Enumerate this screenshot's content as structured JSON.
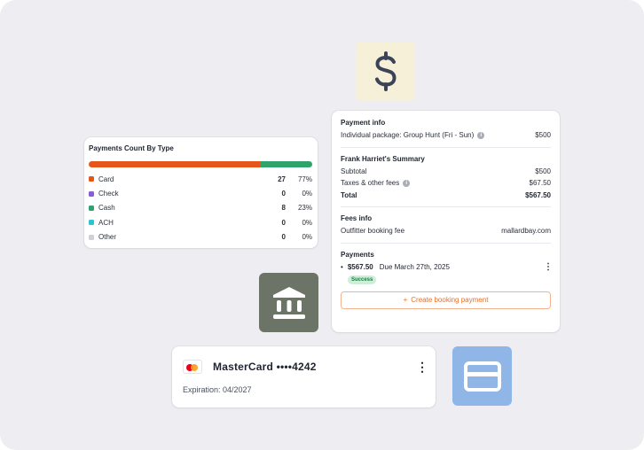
{
  "payments_count": {
    "title": "Payments Count By Type",
    "types": [
      {
        "label": "Card",
        "count": "27",
        "pct": "77%",
        "share": 0.77,
        "color": "#e6551a"
      },
      {
        "label": "Check",
        "count": "0",
        "pct": "0%",
        "share": 0,
        "color": "#8a5bd6"
      },
      {
        "label": "Cash",
        "count": "8",
        "pct": "23%",
        "share": 0.23,
        "color": "#2fa36b"
      },
      {
        "label": "ACH",
        "count": "0",
        "pct": "0%",
        "share": 0,
        "color": "#2cc4d8"
      },
      {
        "label": "Other",
        "count": "0",
        "pct": "0%",
        "share": 0,
        "color": "#cfd1d6"
      }
    ]
  },
  "payment_info": {
    "heading": "Payment info",
    "package_label": "Individual package: Group Hunt (Fri - Sun)",
    "package_price": "$500",
    "summary": {
      "heading": "Frank Harriet's Summary",
      "subtotal_label": "Subtotal",
      "subtotal_value": "$500",
      "taxes_label": "Taxes & other fees",
      "taxes_value": "$67.50",
      "total_label": "Total",
      "total_value": "$567.50"
    },
    "fees": {
      "heading": "Fees info",
      "booking_fee_label": "Outfitter booking fee",
      "booking_fee_value": "mallardbay.com"
    },
    "payments": {
      "heading": "Payments",
      "bullet": "•",
      "amount": "$567.50",
      "due": "Due March 27th, 2025",
      "status": "Success",
      "create_label": "Create booking payment",
      "create_icon": "+"
    },
    "info_icon": "i",
    "more_icon": "⋮"
  },
  "card": {
    "brand": "MasterCard",
    "masked_number": "••••4242",
    "expiration": "Expiration: 04/2027",
    "more_icon": "⋮"
  },
  "icons": {
    "dollar": "dollar-icon",
    "bank": "bank-icon",
    "credit_card": "credit-card-icon"
  },
  "colors": {
    "accent_orange": "#e8702a",
    "success_green": "#1c7a3f",
    "dollar_tile": "#f6f0d9",
    "bank_tile": "#6b7466",
    "card_tile": "#8fb6e6"
  }
}
